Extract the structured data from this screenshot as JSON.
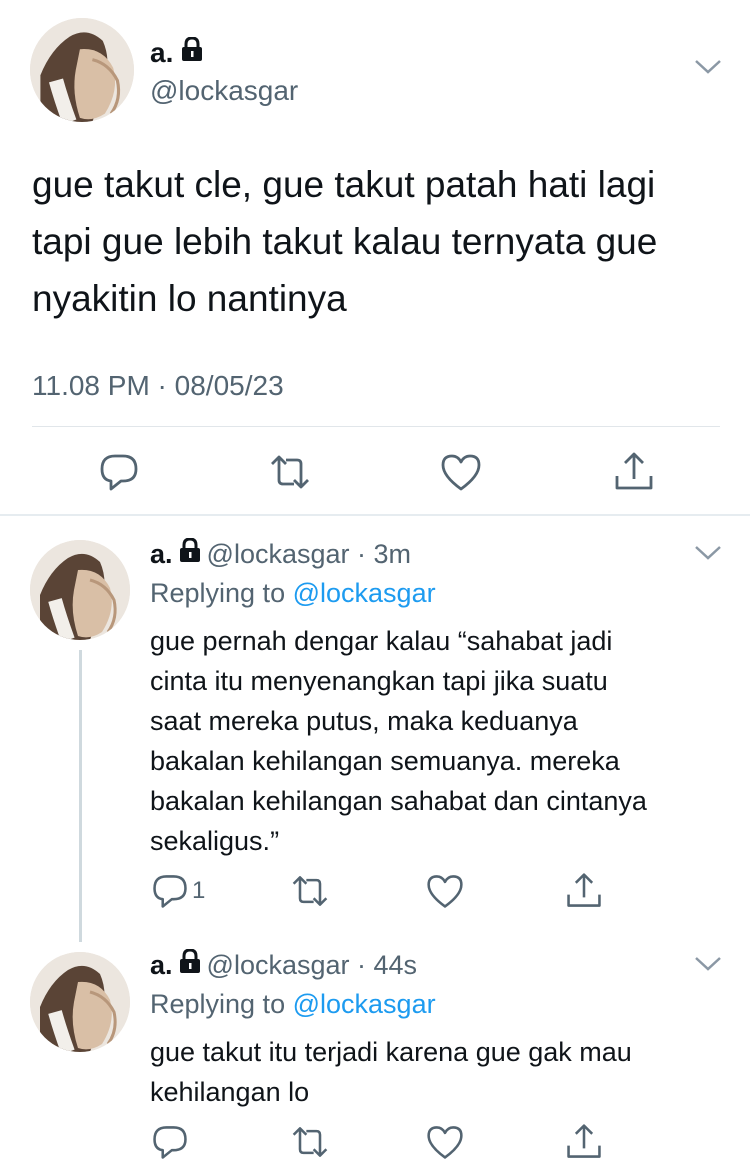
{
  "main_tweet": {
    "name": "a.",
    "handle": "@lockasgar",
    "text_lines": [
      "gue takut cle, gue takut patah hati lagi",
      "tapi gue lebih takut kalau ternyata gue",
      "nyakitin lo nantinya"
    ],
    "timestamp": "11.08 PM · 08/05/23"
  },
  "replies": [
    {
      "name": "a.",
      "handle": "@lockasgar",
      "time": "· 3m",
      "replying_prefix": "Replying to",
      "replying_to": "@lockasgar",
      "text_lines": [
        "gue pernah dengar kalau “sahabat jadi",
        "cinta itu menyenangkan tapi jika suatu",
        "saat mereka putus, maka keduanya",
        "bakalan kehilangan semuanya. mereka",
        "bakalan kehilangan sahabat dan cintanya",
        "sekaligus.”"
      ],
      "reply_count": "1"
    },
    {
      "name": "a.",
      "handle": "@lockasgar",
      "time": "· 44s",
      "replying_prefix": "Replying to",
      "replying_to": "@lockasgar",
      "text_lines": [
        "gue takut itu terjadi karena gue gak mau",
        "kehilangan lo"
      ]
    }
  ],
  "icons": [
    "lock-icon",
    "chevron-down-icon",
    "reply-icon",
    "retweet-icon",
    "like-icon",
    "share-icon"
  ],
  "colors": {
    "link": "#1d9bf0",
    "secondary_text": "#536471",
    "primary_text": "#0f1419",
    "divider": "#e1e6ea"
  }
}
